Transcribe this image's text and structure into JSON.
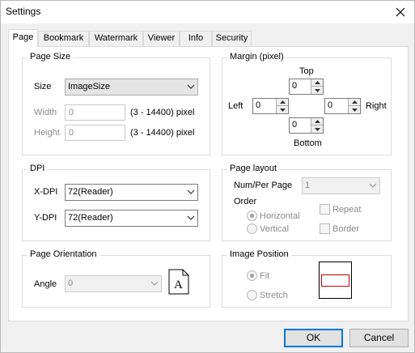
{
  "window": {
    "title": "Settings"
  },
  "tabs": [
    {
      "label": "Page",
      "active": true
    },
    {
      "label": "Bookmark"
    },
    {
      "label": "Watermark"
    },
    {
      "label": "Viewer"
    },
    {
      "label": "Info"
    },
    {
      "label": "Security"
    }
  ],
  "page_size": {
    "title": "Page Size",
    "size_label": "Size",
    "size_value": "ImageSize",
    "width_label": "Width",
    "width_value": "0",
    "width_range": "(3 - 14400) pixel",
    "height_label": "Height",
    "height_value": "0",
    "height_range": "(3 - 14400) pixel"
  },
  "margin": {
    "title": "Margin (pixel)",
    "top_label": "Top",
    "top_value": "0",
    "left_label": "Left",
    "left_value": "0",
    "right_label": "Right",
    "right_value": "0",
    "bottom_label": "Bottom",
    "bottom_value": "0"
  },
  "dpi": {
    "title": "DPI",
    "xdpi_label": "X-DPI",
    "xdpi_value": "72(Reader)",
    "ydpi_label": "Y-DPI",
    "ydpi_value": "72(Reader)"
  },
  "page_layout": {
    "title": "Page layout",
    "num_per_page_label": "Num/Per Page",
    "num_per_page_value": "1",
    "order_label": "Order",
    "horizontal_label": "Horizontal",
    "vertical_label": "Vertical",
    "repeat_label": "Repeat",
    "border_label": "Border",
    "order_selected": "Horizontal"
  },
  "orientation": {
    "title": "Page Orientation",
    "angle_label": "Angle",
    "angle_value": "0",
    "preview_letter": "A"
  },
  "image_position": {
    "title": "Image Position",
    "fit_label": "Fit",
    "stretch_label": "Stretch",
    "selected": "Fit"
  },
  "buttons": {
    "ok": "OK",
    "cancel": "Cancel"
  },
  "icons": {
    "close": "close-icon",
    "dropdown": "chevron-down-icon",
    "spin_up": "triangle-up-icon",
    "spin_down": "triangle-down-icon",
    "document": "document-icon"
  },
  "colors": {
    "accent": "#0078d7",
    "image_frame": "#c00000"
  }
}
